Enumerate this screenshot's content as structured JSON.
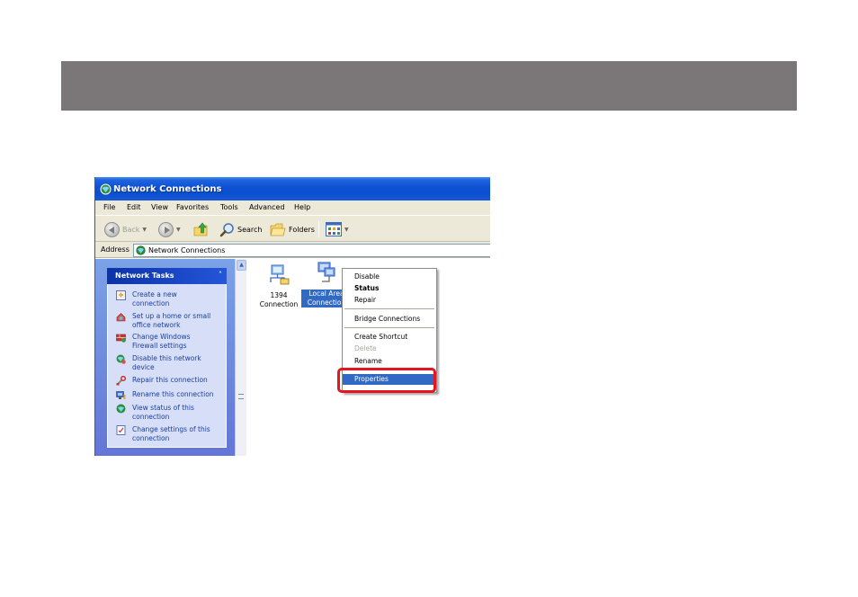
{
  "window": {
    "title": "Network Connections"
  },
  "menubar": {
    "items": [
      "File",
      "Edit",
      "View",
      "Favorites",
      "Tools",
      "Advanced",
      "Help"
    ]
  },
  "toolbar": {
    "back_label": "Back",
    "search_label": "Search",
    "folders_label": "Folders"
  },
  "address": {
    "label": "Address",
    "value": "Network Connections"
  },
  "sidebar": {
    "header": "Network Tasks",
    "collapse_glyph": "˄",
    "tasks": [
      {
        "line1": "Create a new",
        "line2": "connection",
        "icon": "new-connection-icon"
      },
      {
        "line1": "Set up a home or small",
        "line2": "office network",
        "icon": "home-network-icon"
      },
      {
        "line1": "Change Windows",
        "line2": "Firewall settings",
        "icon": "firewall-icon"
      },
      {
        "line1": "Disable this network",
        "line2": "device",
        "icon": "disable-network-icon"
      },
      {
        "line1": "Repair this connection",
        "line2": "",
        "icon": "repair-icon"
      },
      {
        "line1": "Rename this connection",
        "line2": "",
        "icon": "rename-icon"
      },
      {
        "line1": "View status of this",
        "line2": "connection",
        "icon": "status-icon"
      },
      {
        "line1": "Change settings of this",
        "line2": "connection",
        "icon": "settings-icon"
      }
    ]
  },
  "connections": [
    {
      "line1": "1394",
      "line2": "Connection",
      "selected": false
    },
    {
      "line1": "Local Area",
      "line2": "Connection",
      "selected": true
    }
  ],
  "context_menu": {
    "disable": "Disable",
    "status": "Status",
    "repair": "Repair",
    "bridge": "Bridge Connections",
    "shortcut": "Create Shortcut",
    "delete": "Delete",
    "rename": "Rename",
    "properties": "Properties"
  },
  "colors": {
    "header_band": "#7b7677",
    "title_blue": "#0b4fcf",
    "selection_blue": "#316ac5",
    "highlight_red": "#e2161f"
  }
}
